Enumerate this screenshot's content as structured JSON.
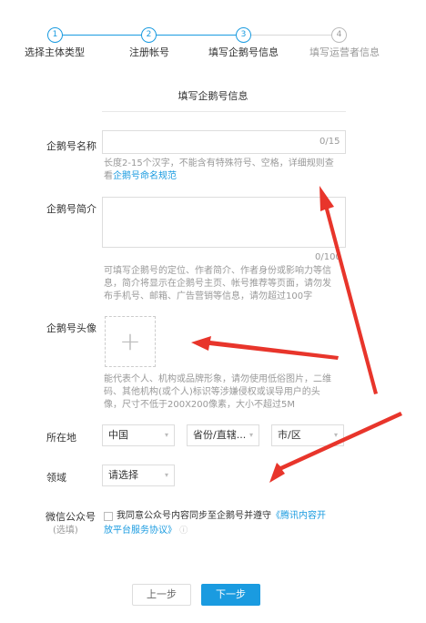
{
  "steps": [
    {
      "number": "1",
      "label": "选择主体类型"
    },
    {
      "number": "2",
      "label": "注册帐号"
    },
    {
      "number": "3",
      "label": "填写企鹅号信息"
    },
    {
      "number": "4",
      "label": "填写运营者信息"
    }
  ],
  "section_title": "填写企鹅号信息",
  "name_field": {
    "label": "企鹅号名称",
    "counter": "0/15",
    "help_line1": "长度2-15个汉字，不能含有特殊符号、空格，详细规则查",
    "help_prefix": "看",
    "help_link": "企鹅号命名规范"
  },
  "intro_field": {
    "label": "企鹅号简介",
    "counter": "0/100",
    "help_line1": "可填写企鹅号的定位、作者简介、作者身份或影响力等信",
    "help_line2": "息，简介将显示在企鹅号主页、帐号推荐等页面，请勿发",
    "help_line3": "布手机号、邮箱、广告营销等信息，请勿超过100字"
  },
  "avatar_field": {
    "label": "企鹅号头像",
    "upload_glyph": "+",
    "help_line1": "能代表个人、机构或品牌形象，请勿使用低俗图片，二维",
    "help_line2": "码、其他机构(或个人)标识等涉嫌侵权或误导用户的头",
    "help_line3": "像，尺寸不低于200X200像素，大小不超过5M"
  },
  "location_field": {
    "label": "所在地",
    "country": "中国",
    "province": "省份/直辖...",
    "city": "市/区"
  },
  "domain_field": {
    "label": "领域",
    "value": "请选择"
  },
  "wechat_field": {
    "label": "微信公众号",
    "sublabel": "(选填)",
    "text": "我同意公众号内容同步至企鹅号并遵守",
    "link_line1": "《腾讯内容开",
    "link_line2": "放平台服务协议》",
    "info_glyph": "ⓘ"
  },
  "buttons": {
    "prev": "上一步",
    "next": "下一步"
  },
  "colors": {
    "accent": "#1a9be0",
    "annotation_arrow": "#e8352b"
  }
}
